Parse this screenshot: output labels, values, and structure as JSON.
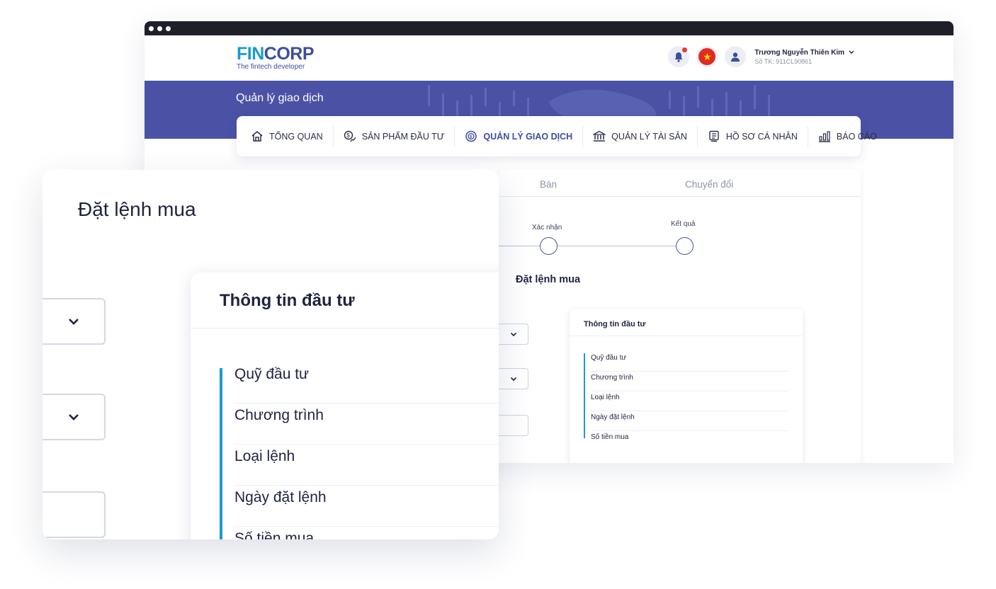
{
  "app": {
    "logo_fin": "FIN",
    "logo_corp": "CORP",
    "logo_tagline": "The fintech developer",
    "user_name": "Trương Nguyễn Thiên Kim",
    "user_account": "Số TK: 911CL90861",
    "banner_title": "Quản lý giao dịch"
  },
  "nav": {
    "items": [
      {
        "label": "TỔNG QUAN",
        "icon": "home-icon"
      },
      {
        "label": "SẢN PHẨM ĐẦU TƯ",
        "icon": "dollar-chart-icon"
      },
      {
        "label": "QUẢN LÝ GIAO DỊCH",
        "icon": "coin-cycle-icon"
      },
      {
        "label": "QUẢN LÝ TÀI SẢN",
        "icon": "bank-icon"
      },
      {
        "label": "HỒ SƠ CÁ NHÂN",
        "icon": "profile-document-icon"
      },
      {
        "label": "BÁO CÁO",
        "icon": "bar-chart-icon"
      }
    ],
    "active_index": 2
  },
  "order": {
    "tabs": [
      "Bán",
      "Chuyển đổi"
    ],
    "steps": [
      "Xác nhận",
      "Kết quả"
    ],
    "title": "Đặt lệnh mua",
    "info_title": "Thông tin đầu tư",
    "info_rows": [
      "Quỹ đầu tư",
      "Chương trình",
      "Loại lệnh",
      "Ngày đặt lệnh",
      "Số tiền mua"
    ]
  },
  "zoom": {
    "title": "Đặt lệnh mua",
    "info_title": "Thông tin đầu tư",
    "info_rows": [
      "Quỹ đầu tư",
      "Chương trình",
      "Loại lệnh",
      "Ngày đặt lệnh",
      "Số tiền mua"
    ]
  },
  "colors": {
    "brand_blue": "#3c4ea0",
    "brand_cyan": "#1a9ad6",
    "banner": "#4b52a5",
    "notification": "#e53935"
  }
}
